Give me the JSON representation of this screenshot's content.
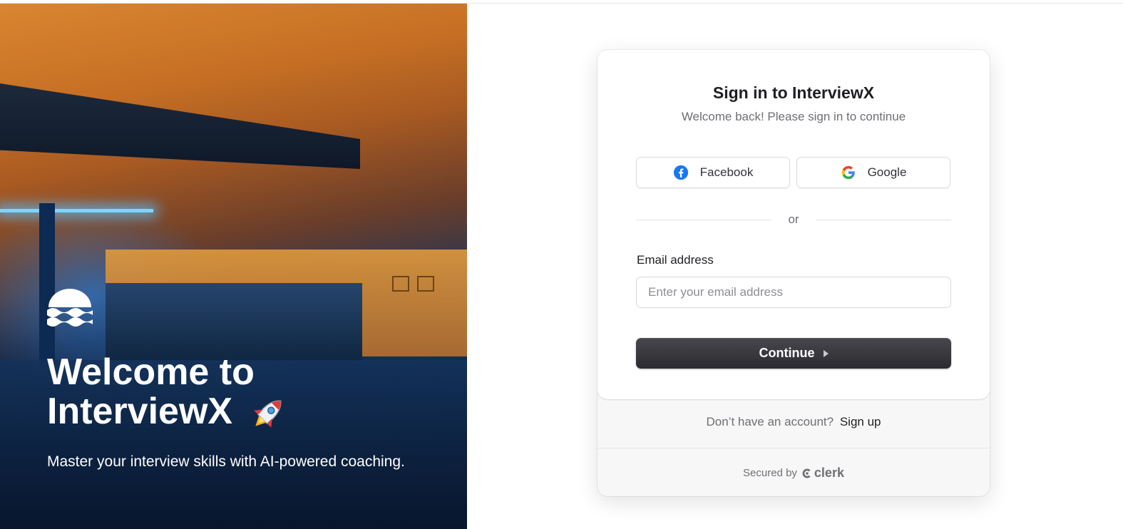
{
  "hero": {
    "title_line1": "Welcome to",
    "title_line2": "InterviewX",
    "title_emoji_icon": "rocket-icon",
    "subtitle": "Master your interview skills with AI-powered coaching.",
    "logo_icon": "waves-sun-logo-icon"
  },
  "card": {
    "title": "Sign in to InterviewX",
    "subtitle": "Welcome back! Please sign in to continue",
    "social": {
      "facebook_label": "Facebook",
      "google_label": "Google"
    },
    "divider_text": "or",
    "email": {
      "label": "Email address",
      "placeholder": "Enter your email address",
      "value": ""
    },
    "continue_label": "Continue",
    "footer": {
      "prompt": "Don’t have an account?",
      "signup_link": "Sign up",
      "secured_by": "Secured by",
      "brand": "clerk"
    }
  },
  "colors": {
    "button_dark": "#2b2b30",
    "facebook_blue": "#1877f2",
    "text_primary": "#1f1f23",
    "text_muted": "#6f6f75"
  }
}
